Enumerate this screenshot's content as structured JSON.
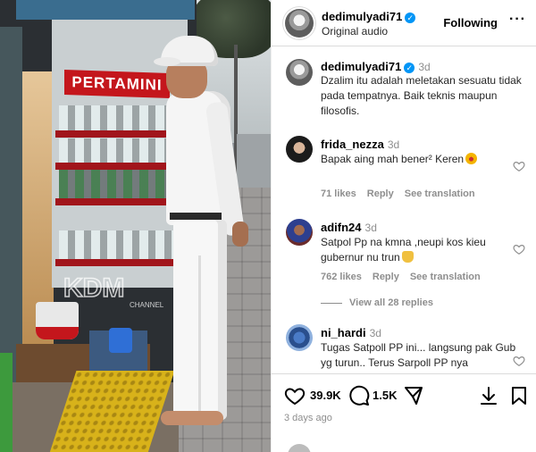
{
  "post": {
    "author": "dedimulyadi71",
    "audio": "Original audio",
    "follow_label": "Following",
    "more_label": "···",
    "caption_time": "3d",
    "caption": "Dzalim itu adalah meletakan sesuatu tidak pada tempatnya. Baik teknis maupun filosofis.",
    "photo_sign": "PERTAMINI",
    "photo_watermark": "KDM CHANNEL"
  },
  "comments": [
    {
      "username": "frida_nezza",
      "time": "3d",
      "text": "Bapak aing mah bener² Keren",
      "likes": "71 likes",
      "reply": "Reply",
      "translate": "See translation"
    },
    {
      "username": "adifn24",
      "time": "3d",
      "text": "Satpol Pp na kmna ,neupi kos kieu gubernur nu trun",
      "likes": "762 likes",
      "reply": "Reply",
      "translate": "See translation"
    },
    {
      "username": "ni_hardi",
      "time": "3d",
      "text": "Tugas Satpoll PP ini... langsung pak Gub yg turun.. Terus Sarpoll PP nya"
    }
  ],
  "view_replies": "View all 28 replies",
  "actions": {
    "likes": "39.9K",
    "comments": "1.5K",
    "posted": "3 days ago"
  },
  "colors": {
    "verified": "#0095f6",
    "muted": "#8e8e8e",
    "pertamini_red": "#c4161c"
  }
}
